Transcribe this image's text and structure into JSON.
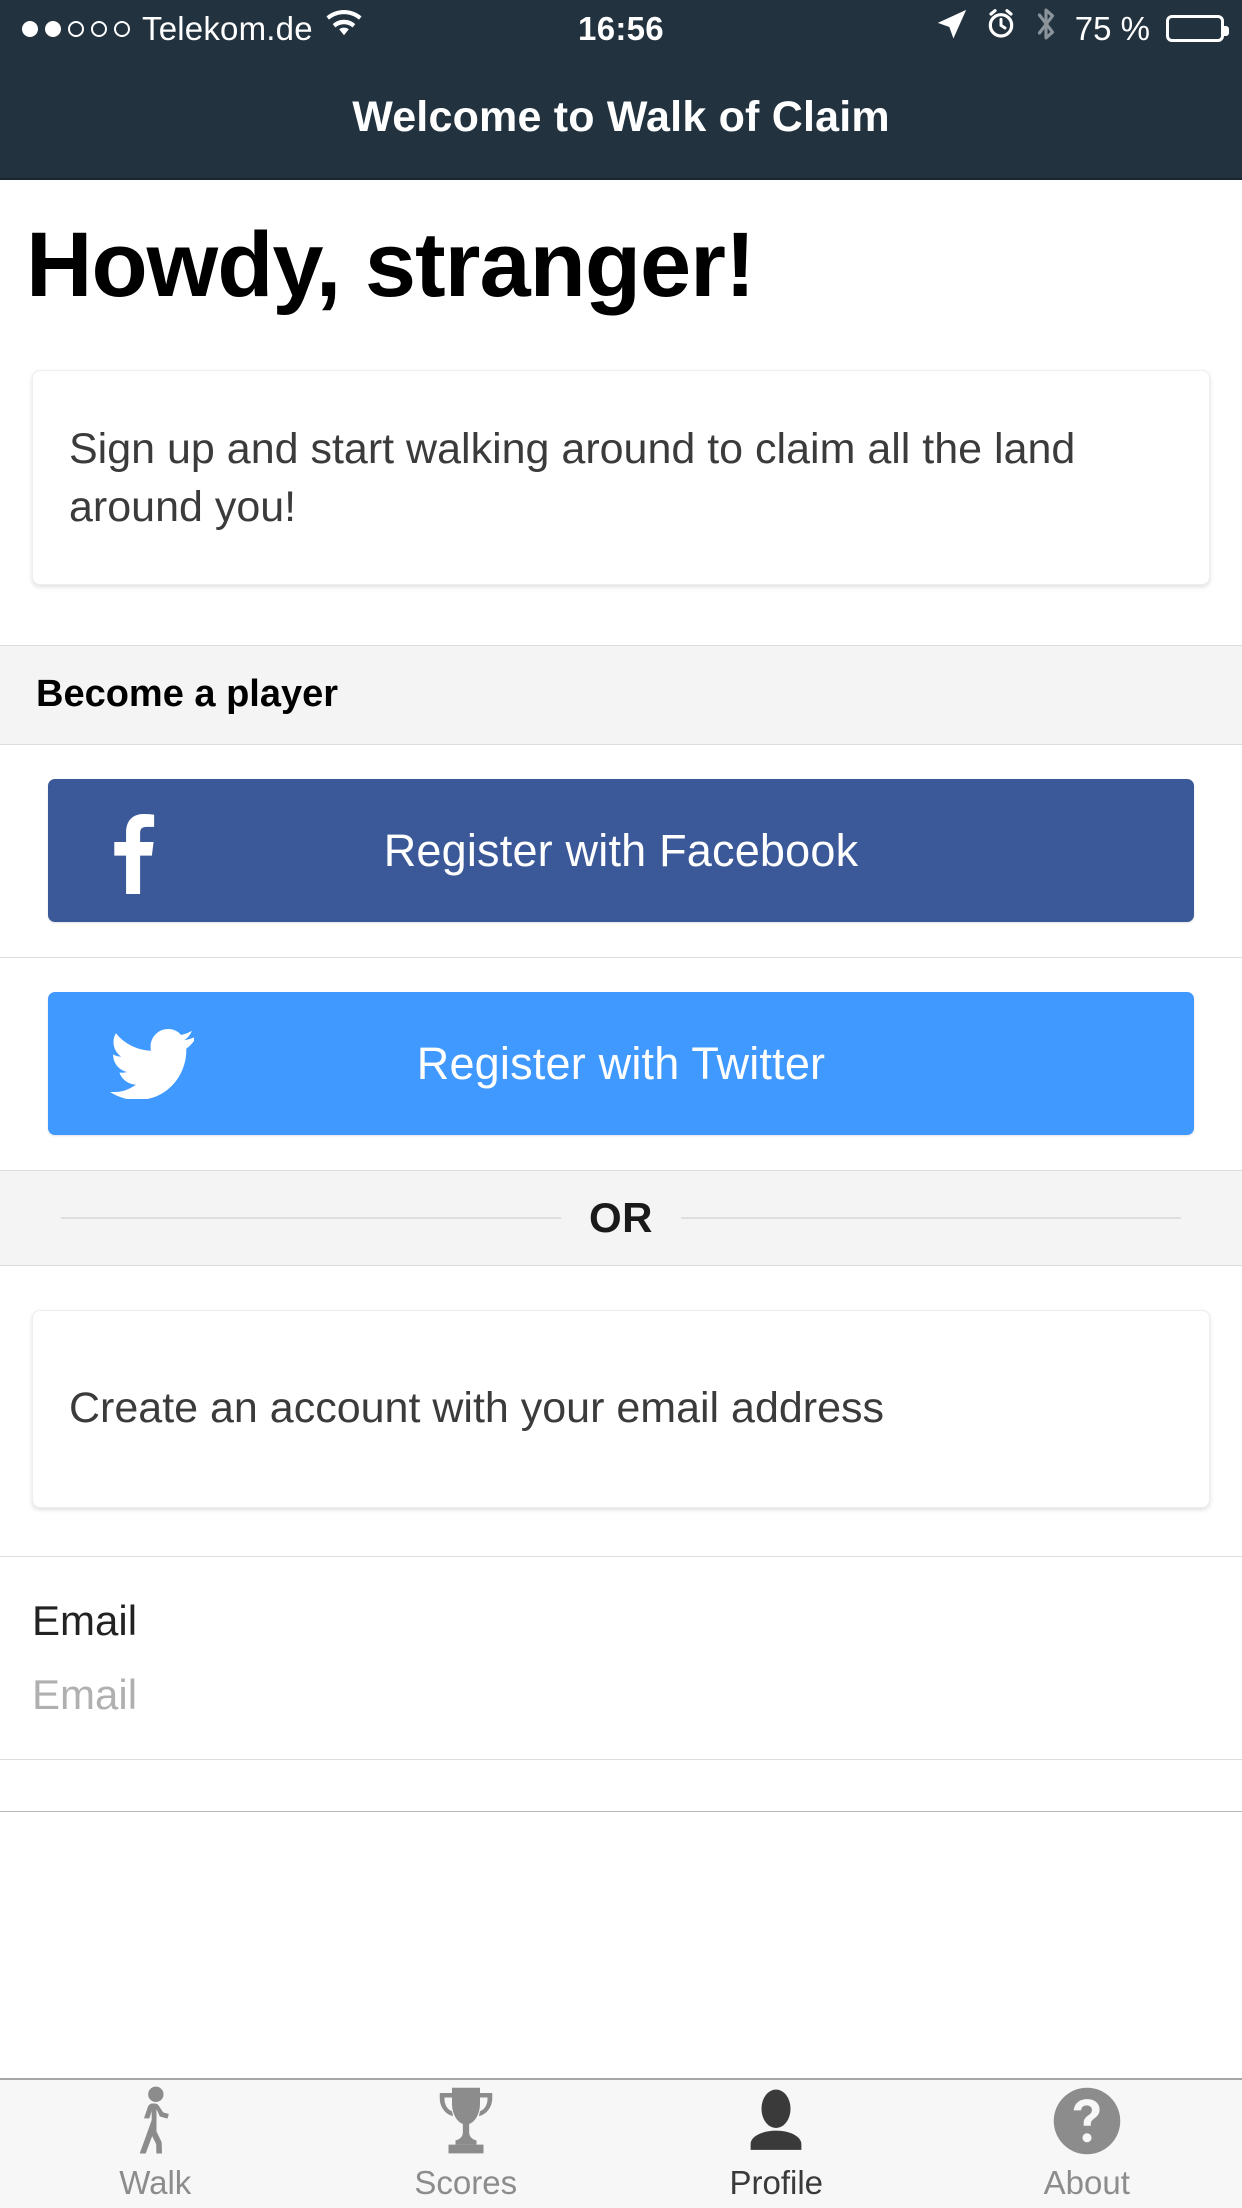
{
  "status_bar": {
    "signal_dots_filled": 2,
    "signal_dots_total": 5,
    "carrier": "Telekom.de",
    "wifi_icon": "wifi-icon",
    "time": "16:56",
    "location_icon": "location-arrow-icon",
    "alarm_icon": "alarm-clock-icon",
    "bluetooth_icon": "bluetooth-icon",
    "battery_percent": "75 %",
    "battery_level": 75,
    "battery_icon": "battery-icon"
  },
  "nav_bar": {
    "title": "Welcome to Walk of Claim"
  },
  "main": {
    "page_title": "Howdy, stranger!",
    "intro_card": {
      "text": "Sign up and start walking around to claim all the land around you!"
    },
    "section_header": {
      "label": "Become a player"
    },
    "facebook_button": {
      "label": "Register with Facebook",
      "icon": "facebook-f-icon",
      "color": "#3b5998"
    },
    "twitter_button": {
      "label": "Register with Twitter",
      "icon": "twitter-bird-icon",
      "color": "#4099ff"
    },
    "or_divider": {
      "label": "OR"
    },
    "email_card": {
      "text": "Create an account with your email address"
    },
    "email_field": {
      "label": "Email",
      "placeholder": "Email",
      "value": ""
    }
  },
  "tab_bar": {
    "items": [
      {
        "label": "Walk",
        "icon": "walking-person-icon",
        "active": false
      },
      {
        "label": "Scores",
        "icon": "trophy-icon",
        "active": false
      },
      {
        "label": "Profile",
        "icon": "person-icon",
        "active": true
      },
      {
        "label": "About",
        "icon": "question-circle-icon",
        "active": false
      }
    ]
  },
  "theme": {
    "nav_background": "#22323f",
    "facebook_blue": "#3b5998",
    "twitter_blue": "#4099ff",
    "section_background": "#f4f4f4",
    "tab_active_color": "#3a3a3a",
    "tab_inactive_color": "#8c8c8c"
  }
}
